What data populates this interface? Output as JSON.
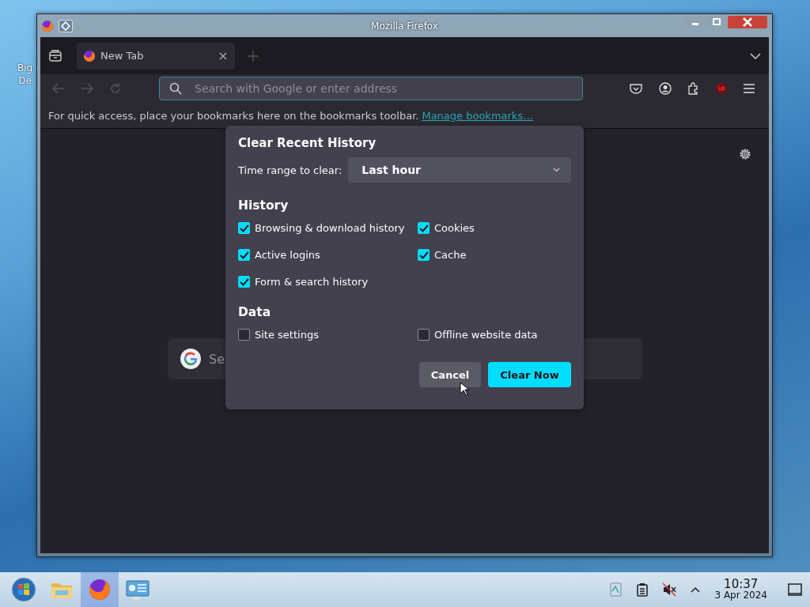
{
  "desktop_icon": {
    "label_lines": [
      "Big",
      "De"
    ]
  },
  "window": {
    "title": "Mozilla Firefox"
  },
  "tabs": [
    {
      "label": "New Tab",
      "selected": true
    }
  ],
  "address_bar": {
    "placeholder": "Search with Google or enter address"
  },
  "bookmarks_bar": {
    "message": "For quick access, place your bookmarks here on the bookmarks toolbar.",
    "link": "Manage bookmarks…"
  },
  "new_tab_search": {
    "placeholder": "Se"
  },
  "dialog": {
    "title": "Clear Recent History",
    "time_range_label": "Time range to clear:",
    "time_range_value": "Last hour",
    "sections": [
      {
        "heading": "History",
        "options": [
          {
            "label": "Browsing & download history",
            "checked": true
          },
          {
            "label": "Cookies",
            "checked": true
          },
          {
            "label": "Active logins",
            "checked": true
          },
          {
            "label": "Cache",
            "checked": true
          },
          {
            "label": "Form & search history",
            "checked": true
          }
        ]
      },
      {
        "heading": "Data",
        "options": [
          {
            "label": "Site settings",
            "checked": false
          },
          {
            "label": "Offline website data",
            "checked": false
          }
        ]
      }
    ],
    "buttons": [
      {
        "label": "Cancel",
        "kind": "secondary"
      },
      {
        "label": "Clear Now",
        "kind": "primary"
      }
    ]
  },
  "taskbar": {
    "apps": [
      {
        "kind": "start",
        "selected": false
      },
      {
        "kind": "files",
        "selected": false
      },
      {
        "kind": "firefox",
        "selected": true
      },
      {
        "kind": "monitor",
        "selected": false
      }
    ],
    "time": "10:37",
    "date": "3 Apr 2024"
  }
}
